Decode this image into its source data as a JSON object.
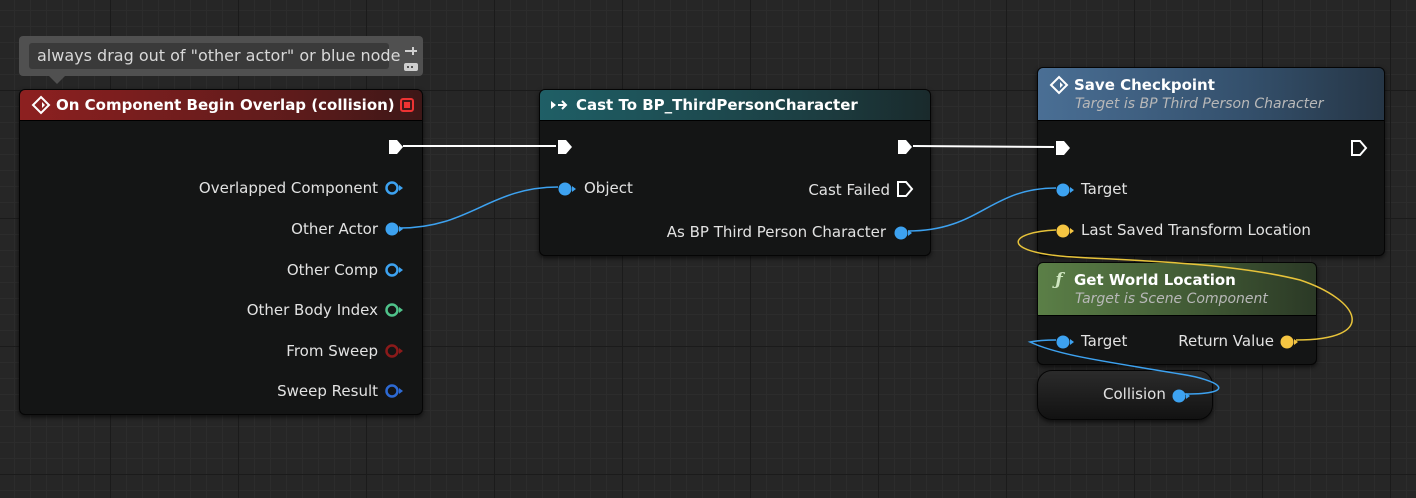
{
  "comment": {
    "text": "always drag out of \"other actor\" or blue node"
  },
  "event_node": {
    "title": "On Component Begin Overlap (collision)",
    "pins": [
      "Overlapped Component",
      "Other Actor",
      "Other Comp",
      "Other Body Index",
      "From Sweep",
      "Sweep Result"
    ]
  },
  "cast_node": {
    "title": "Cast To BP_ThirdPersonCharacter",
    "object_label": "Object",
    "cast_failed_label": "Cast Failed",
    "as_label": "As BP Third Person Character"
  },
  "save_node": {
    "title": "Save Checkpoint",
    "subtitle": "Target is BP Third Person Character",
    "target_label": "Target",
    "location_label": "Last Saved Transform Location"
  },
  "getloc_node": {
    "title": "Get World Location",
    "subtitle": "Target is Scene Component",
    "target_label": "Target",
    "return_label": "Return Value"
  },
  "var_node": {
    "label": "Collision"
  },
  "colors": {
    "object_pin": "#3da2f0",
    "bool_pin": "#8b1a1a",
    "int_pin": "#4fc28a",
    "vector_pin": "#f5c542",
    "struct_pin": "#2d6ad4",
    "event_header": "#8a1e1e",
    "cast_header": "#1e5a60",
    "function_header": "#3e5f82",
    "pure_header": "#4d6b3c",
    "exec_wire": "#ffffff"
  },
  "icons": {
    "event": "event-diamond-icon",
    "cast": "cast-arrow-icon",
    "function": "function-f-icon",
    "pin": "pin-icon",
    "delegate": "delegate-square-icon"
  }
}
